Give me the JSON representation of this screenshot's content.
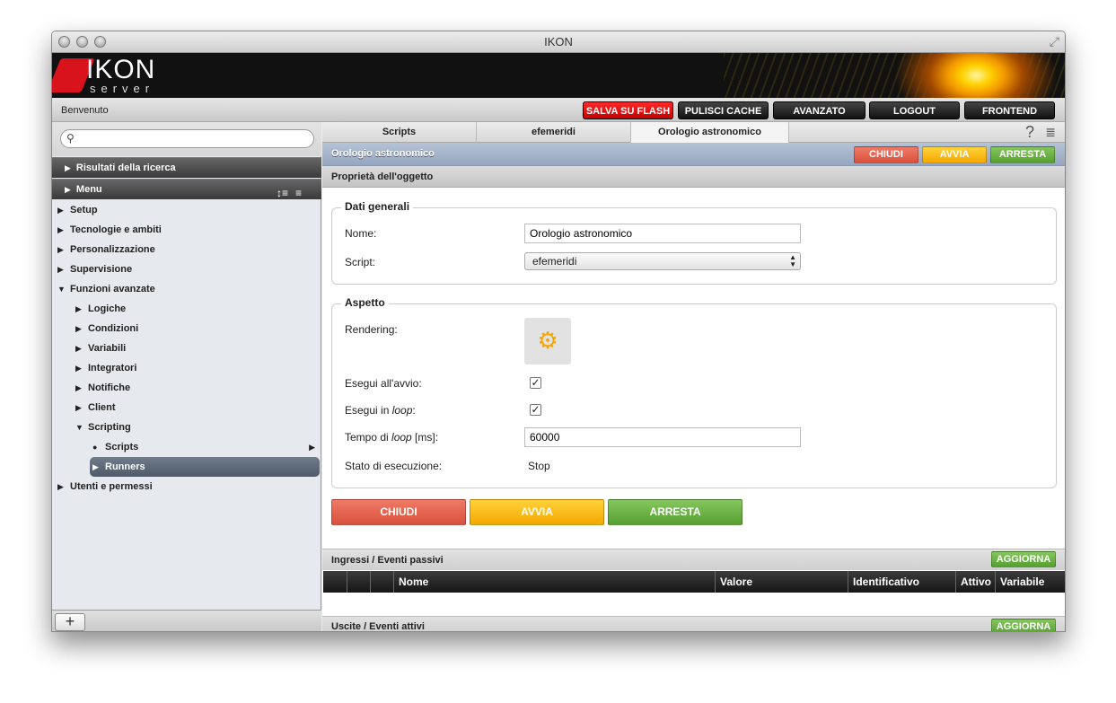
{
  "window": {
    "title": "IKON"
  },
  "brand": {
    "logo_text": "IKON",
    "logo_sub": "server"
  },
  "toolbar": {
    "welcome": "Benvenuto",
    "salva_label": "SALVA SU FLASH",
    "pulisci_label": "PULISCI CACHE",
    "avanzato_label": "AVANZATO",
    "logout_label": "LOGOUT",
    "frontend_label": "FRONTEND"
  },
  "sidebar": {
    "search_placeholder": "",
    "results_label": "Risultati della ricerca",
    "menu_label": "Menu",
    "items": [
      {
        "label": "Setup",
        "arrow": "▶"
      },
      {
        "label": "Tecnologie e ambiti",
        "arrow": "▶"
      },
      {
        "label": "Personalizzazione",
        "arrow": "▶"
      },
      {
        "label": "Supervisione",
        "arrow": "▶"
      },
      {
        "label": "Funzioni avanzate",
        "arrow": "▼"
      },
      {
        "label": "Logiche",
        "arrow": "▶"
      },
      {
        "label": "Condizioni",
        "arrow": "▶"
      },
      {
        "label": "Variabili",
        "arrow": "▶"
      },
      {
        "label": "Integratori",
        "arrow": "▶"
      },
      {
        "label": "Notifiche",
        "arrow": "▶"
      },
      {
        "label": "Client",
        "arrow": "▶"
      },
      {
        "label": "Scripting",
        "arrow": "▼"
      },
      {
        "label": "Scripts",
        "arrow": "●"
      },
      {
        "label": "Runners",
        "arrow": "▶"
      },
      {
        "label": "Utenti e permessi",
        "arrow": "▶"
      }
    ],
    "add_label": "+"
  },
  "tabs": [
    {
      "label": "Scripts"
    },
    {
      "label": "efemeridi"
    },
    {
      "label": "Orologio astronomico"
    }
  ],
  "object": {
    "title": "Orologio astronomico",
    "chiudi": "CHIUDI",
    "avvia": "AVVIA",
    "arresta": "ARRESTA"
  },
  "props": {
    "header": "Proprietà dell'oggetto",
    "general_legend": "Dati generali",
    "nome_label": "Nome:",
    "nome_value": "Orologio astronomico",
    "script_label": "Script:",
    "script_value": "efemeridi",
    "aspect_legend": "Aspetto",
    "rendering_label": "Rendering:",
    "startup_label": "Esegui all'avvio:",
    "loop_label_a": "Esegui in ",
    "loop_label_b": "loop",
    "loop_label_c": ":",
    "time_label_a": "Tempo di ",
    "time_label_b": "loop",
    "time_label_c": " [ms]:",
    "time_value": "60000",
    "state_label": "Stato di esecuzione:",
    "state_value": "Stop",
    "check_glyph": "✓"
  },
  "actions": {
    "chiudi": "CHIUDI",
    "avvia": "AVVIA",
    "arresta": "ARRESTA"
  },
  "inputs_grid": {
    "title": "Ingressi / Eventi passivi",
    "refresh": "AGGIORNA",
    "columns": [
      "Nome",
      "Valore",
      "Identificativo",
      "Attivo",
      "Variabile"
    ]
  },
  "outputs_grid": {
    "title": "Uscite / Eventi attivi",
    "refresh": "AGGIORNA"
  },
  "icons": {
    "help": "?",
    "doc": "≣",
    "search": "⚲",
    "gear": "⚙"
  }
}
